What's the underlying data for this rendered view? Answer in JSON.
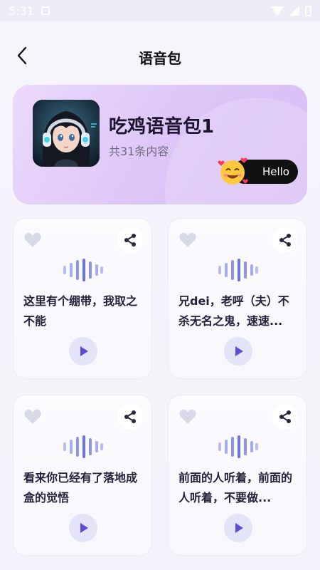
{
  "status_bar": {
    "time": "5:31"
  },
  "header": {
    "title": "语音包"
  },
  "pack": {
    "name": "吃鸡语音包1",
    "count_text": "共31条内容",
    "greeting": "Hello"
  },
  "voices": [
    {
      "text": "这里有个绷带，我取之不能"
    },
    {
      "text": "兄dei，老呼（夫）不杀无名之鬼，速速..."
    },
    {
      "text": "看来你已经有了落地成盒的觉悟"
    },
    {
      "text": "前面的人听着，前面的人听着，不要做..."
    }
  ],
  "colors": {
    "accent": "#5b4fd9",
    "card_gradient_start": "#ecd9fb",
    "card_gradient_end": "#d8bff5"
  }
}
